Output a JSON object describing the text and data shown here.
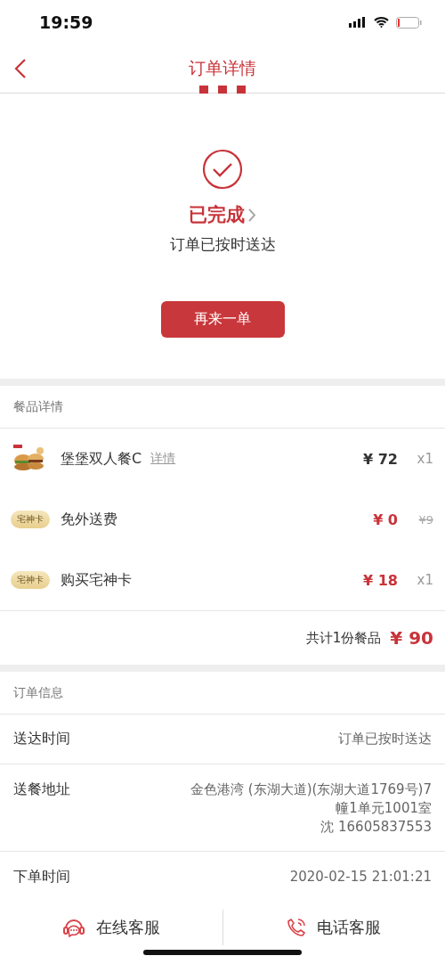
{
  "status_bar": {
    "time": "19:59"
  },
  "nav": {
    "title": "订单详情"
  },
  "order_status": {
    "status": "已完成",
    "subtitle": "订单已按时送达",
    "reorder_button": "再来一单"
  },
  "meal_details": {
    "header": "餐品详情",
    "items": [
      {
        "kind": "food",
        "name": "堡堡双人餐C",
        "link": "详情",
        "price": "¥ 72",
        "highlighted": false,
        "quantity": "x1"
      },
      {
        "kind": "card",
        "badge": "宅神卡",
        "name": "免外送费",
        "price": "¥ 0",
        "highlighted": true,
        "original_price": "¥9"
      },
      {
        "kind": "card",
        "badge": "宅神卡",
        "name": "购买宅神卡",
        "price": "¥ 18",
        "highlighted": true,
        "quantity": "x1"
      }
    ],
    "total_label": "共计1份餐品",
    "total": "¥ 90"
  },
  "order_info": {
    "header": "订单信息",
    "rows": [
      {
        "label": "送达时间",
        "value_lines": [
          "订单已按时送达"
        ]
      },
      {
        "label": "送餐地址",
        "value_lines": [
          "金色港湾 (东湖大道)(东湖大道1769号)7",
          "幢1单元1001室",
          "沈 16605837553"
        ]
      },
      {
        "label": "下单时间",
        "value_lines": [
          "2020-02-15 21:01:21"
        ]
      }
    ]
  },
  "bottom_bar": [
    {
      "kind": "chat",
      "label": "在线客服"
    },
    {
      "kind": "phone",
      "label": "电话客服"
    }
  ]
}
